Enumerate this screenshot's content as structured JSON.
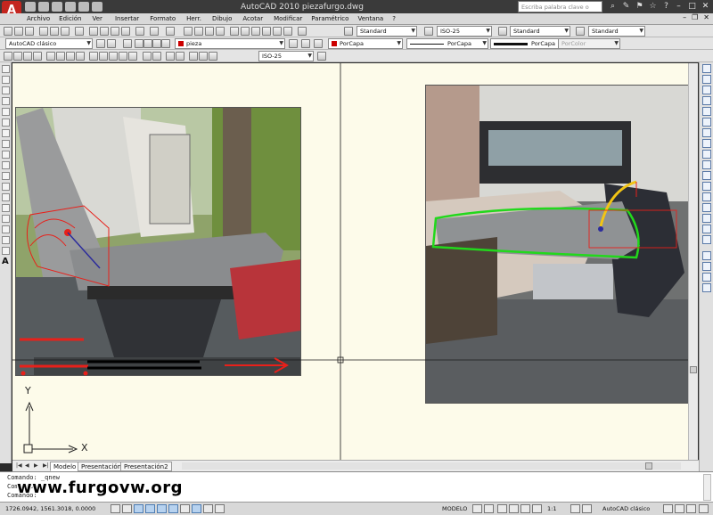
{
  "window": {
    "title": "AutoCAD 2010    piezafurgo.dwg",
    "search_placeholder": "Escriba palabra clave o frase",
    "logo_letter": "A"
  },
  "menu": {
    "items": [
      "Archivo",
      "Edición",
      "Ver",
      "Insertar",
      "Formato",
      "Herr.",
      "Dibujo",
      "Acotar",
      "Modificar",
      "Paramétrico",
      "Ventana",
      "?"
    ]
  },
  "toolbar1": {
    "text_style": "Standard",
    "dim_style": "ISO-25",
    "table_style": "Standard",
    "multileader_style": "Standard"
  },
  "toolbar2": {
    "workspace": "AutoCAD clásico",
    "layer": "pieza",
    "color": "PorCapa",
    "linetype": "PorCapa",
    "lineweight": "PorCapa",
    "plotstyle": "PorColor"
  },
  "toolbar3": {
    "dim_style": "ISO-25"
  },
  "ucs": {
    "x_label": "X",
    "y_label": "Y"
  },
  "tabs": [
    "Modelo",
    "Presentación1",
    "Presentación2"
  ],
  "command_line": {
    "line1": "Comando: _qnew",
    "line2": "Comando:",
    "line3": "Comando:"
  },
  "watermark": "www.furgovw.org",
  "status": {
    "coords": "1726.0942, 1561.3018, 0.0000",
    "model": "MODELO",
    "scale": "1:1",
    "workspace": "AutoCAD clásico"
  },
  "colors": {
    "annotation_red": "#e8201a",
    "outline_green": "#22d81c",
    "arc_yellow": "#f2c414",
    "canvas": "#fdfbea"
  }
}
